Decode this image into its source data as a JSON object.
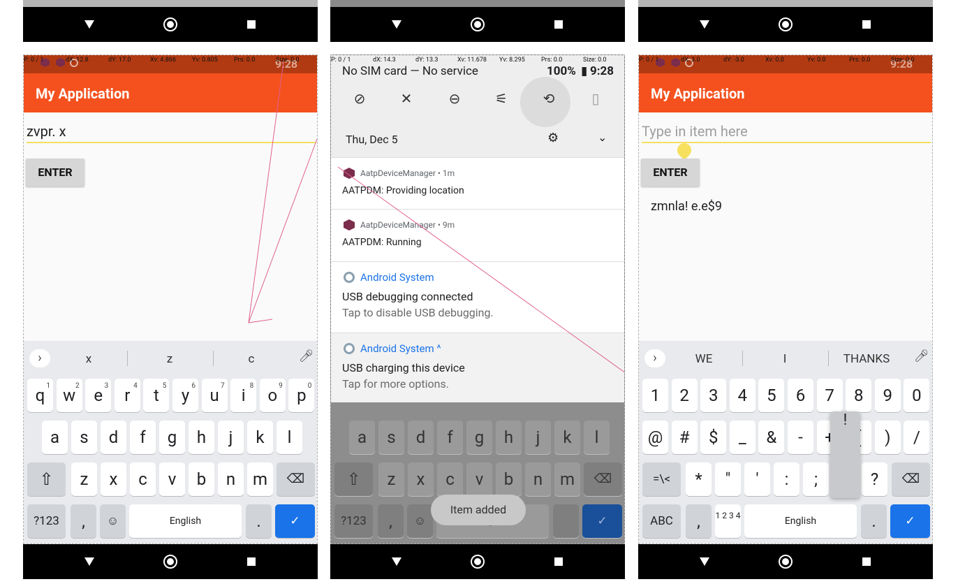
{
  "nav_icons": [
    "back-triangle-icon",
    "home-circle-icon",
    "recents-square-icon"
  ],
  "colors": {
    "appbar": "#f4511e",
    "statusbar": "#b23a12",
    "accent_blue": "#1a73e8",
    "input_underline": "#f6e05e",
    "trace": "#e06090"
  },
  "phone1": {
    "debug": {
      "p": "P: 0 / 1",
      "dx": "dX: 12.8",
      "dy": "dY: 17.0",
      "xv": "Xv: 4.866",
      "yv": "Yv: 0.805",
      "prs": "Prs: 0.0",
      "size": "Size: 0.0",
      "time": "9:28"
    },
    "app_title": "My Application",
    "input_value": "zvpr. x",
    "enter_label": "ENTER",
    "suggestions": [
      "x",
      "z",
      "c"
    ],
    "rows": {
      "r1": [
        "q",
        "w",
        "e",
        "r",
        "t",
        "y",
        "u",
        "i",
        "o",
        "p"
      ],
      "r1_hints": [
        "1",
        "2",
        "3",
        "4",
        "5",
        "6",
        "7",
        "8",
        "9",
        "0"
      ],
      "r2": [
        "a",
        "s",
        "d",
        "f",
        "g",
        "h",
        "j",
        "k",
        "l"
      ],
      "r3": [
        "z",
        "x",
        "c",
        "v",
        "b",
        "n",
        "m"
      ]
    },
    "sym_key": "?123",
    "comma": ",",
    "space": "English",
    "period": "."
  },
  "phone2": {
    "debug": {
      "p": "P: 0 / 1",
      "dx": "dX: 14.3",
      "dy": "dY: 13.3",
      "xv": "Xv: 11.678",
      "yv": "Yv: 8.295",
      "prs": "Prs: 0.0",
      "size": "Size: 0.0"
    },
    "carrier": "No SIM card — No service",
    "battery": "100%",
    "time": "9:28",
    "date": "Thu, Dec 5",
    "notifications": [
      {
        "app": "AatpDeviceManager • 1m",
        "title": "AATPDM: Providing location"
      },
      {
        "app": "AatpDeviceManager • 9m",
        "title": "AATPDM: Running"
      },
      {
        "app": "Android System",
        "title": "USB debugging connected",
        "sub": "Tap to disable USB debugging."
      },
      {
        "app": "Android System ^",
        "title": "USB charging this device",
        "sub": "Tap for more options."
      }
    ],
    "rows": {
      "r2": [
        "a",
        "s",
        "d",
        "f",
        "g",
        "h",
        "j",
        "k",
        "l"
      ],
      "r3": [
        "z",
        "x",
        "c",
        "v",
        "b",
        "n",
        "m"
      ]
    },
    "sym_key": "?123",
    "comma": ",",
    "space": "English",
    "toast": "Item added"
  },
  "phone3": {
    "debug": {
      "p": "P: 0 / 1",
      "dx": "dX: 3.0",
      "dy": "dY: -3.0",
      "xv": "Xv: 0.0",
      "yv": "Yv: 0.0",
      "prs": "Prs: 0.0",
      "size": "Size: 0.0",
      "time": "9:28"
    },
    "app_title": "My Application",
    "input_placeholder": "Type in item here",
    "enter_label": "ENTER",
    "list_item": "zmnla! e.e$9",
    "suggestions": [
      "WE",
      "I",
      "THANKS"
    ],
    "rows": {
      "r1": [
        "1",
        "2",
        "3",
        "4",
        "5",
        "6",
        "7",
        "8",
        "9",
        "0"
      ],
      "r2": [
        "@",
        "#",
        "$",
        "_",
        "&",
        "-",
        "+",
        "(",
        ")",
        "/"
      ],
      "r3": [
        "*",
        "\"",
        "'",
        ":",
        ";",
        "!",
        "?"
      ]
    },
    "shift_key": "=\\<",
    "popup": "!",
    "abc_key": "ABC",
    "comma": ",",
    "numpad": "1 2 3 4",
    "space": "English",
    "period": "."
  }
}
